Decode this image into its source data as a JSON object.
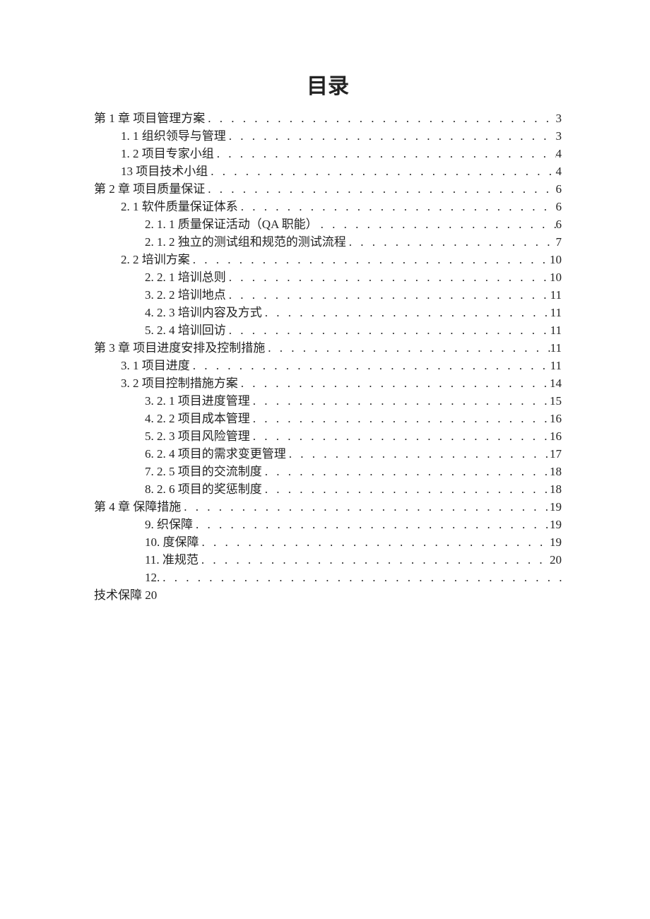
{
  "title": "目录",
  "toc": [
    {
      "level": 1,
      "label": "第 1 章 项目管理方案 ",
      "page": "3"
    },
    {
      "level": 2,
      "label": "1. 1 组织领导与管理",
      "page": "3"
    },
    {
      "level": 2,
      "label": "1. 2 项目专家小组",
      "page": "4"
    },
    {
      "level": 2,
      "label": "13 项目技术小组",
      "page": "4"
    },
    {
      "level": 1,
      "label": "第 2 章 项目质量保证 ",
      "page": "6"
    },
    {
      "level": 2,
      "label": "2. 1 软件质量保证体系",
      "page": "6"
    },
    {
      "level": 3,
      "label": "2.  1. 1 质量保证活动（QA 职能） ",
      "page": "6"
    },
    {
      "level": 3,
      "label": "2. 1.  2 独立的测试组和规范的测试流程",
      "page": "7"
    },
    {
      "level": 2,
      "label": "2.  2 培训方案 ",
      "page": "10"
    },
    {
      "level": 3,
      "label": "2.  2. 1 培训总则",
      "page": "10"
    },
    {
      "level": 3,
      "label": "3.  2. 2 培训地点",
      "page": "11"
    },
    {
      "level": 3,
      "label": "4.  2. 3 培训内容及方式",
      "page": "11"
    },
    {
      "level": 3,
      "label": "5.  2. 4 培训回访",
      "page": "11"
    },
    {
      "level": 1,
      "label": "第 3 章 项目进度安排及控制措施 ",
      "page": "11"
    },
    {
      "level": 2,
      "label": "3.  1 项目进度 ",
      "page": "11"
    },
    {
      "level": 2,
      "label": "3. 2 项目控制措施方案 ",
      "page": "14"
    },
    {
      "level": 3,
      "label": "3.  2. 1 项目进度管理",
      "page": "15"
    },
    {
      "level": 3,
      "label": "4.  2. 2 项目成本管理",
      "page": "16"
    },
    {
      "level": 3,
      "label": "5.  2. 3 项目风险管理",
      "page": "16"
    },
    {
      "level": 3,
      "label": "6.  2. 4 项目的需求变更管理",
      "page": "17"
    },
    {
      "level": 3,
      "label": "7.  2. 5 项目的交流制度",
      "page": "18"
    },
    {
      "level": 3,
      "label": "8.  2. 6 项目的奖惩制度",
      "page": "18"
    },
    {
      "level": 1,
      "label": "第 4 章 保障措施 ",
      "page": "19"
    },
    {
      "level": 3,
      "label": "9.      织保障 ",
      "page": "19"
    },
    {
      "level": 3,
      "label": "10.     度保障 ",
      "page": "19"
    },
    {
      "level": 3,
      "label": "11.     准规范 ",
      "page": "20"
    },
    {
      "level": 3,
      "label": "12.",
      "page": ""
    }
  ],
  "tail": "技术保障    20"
}
